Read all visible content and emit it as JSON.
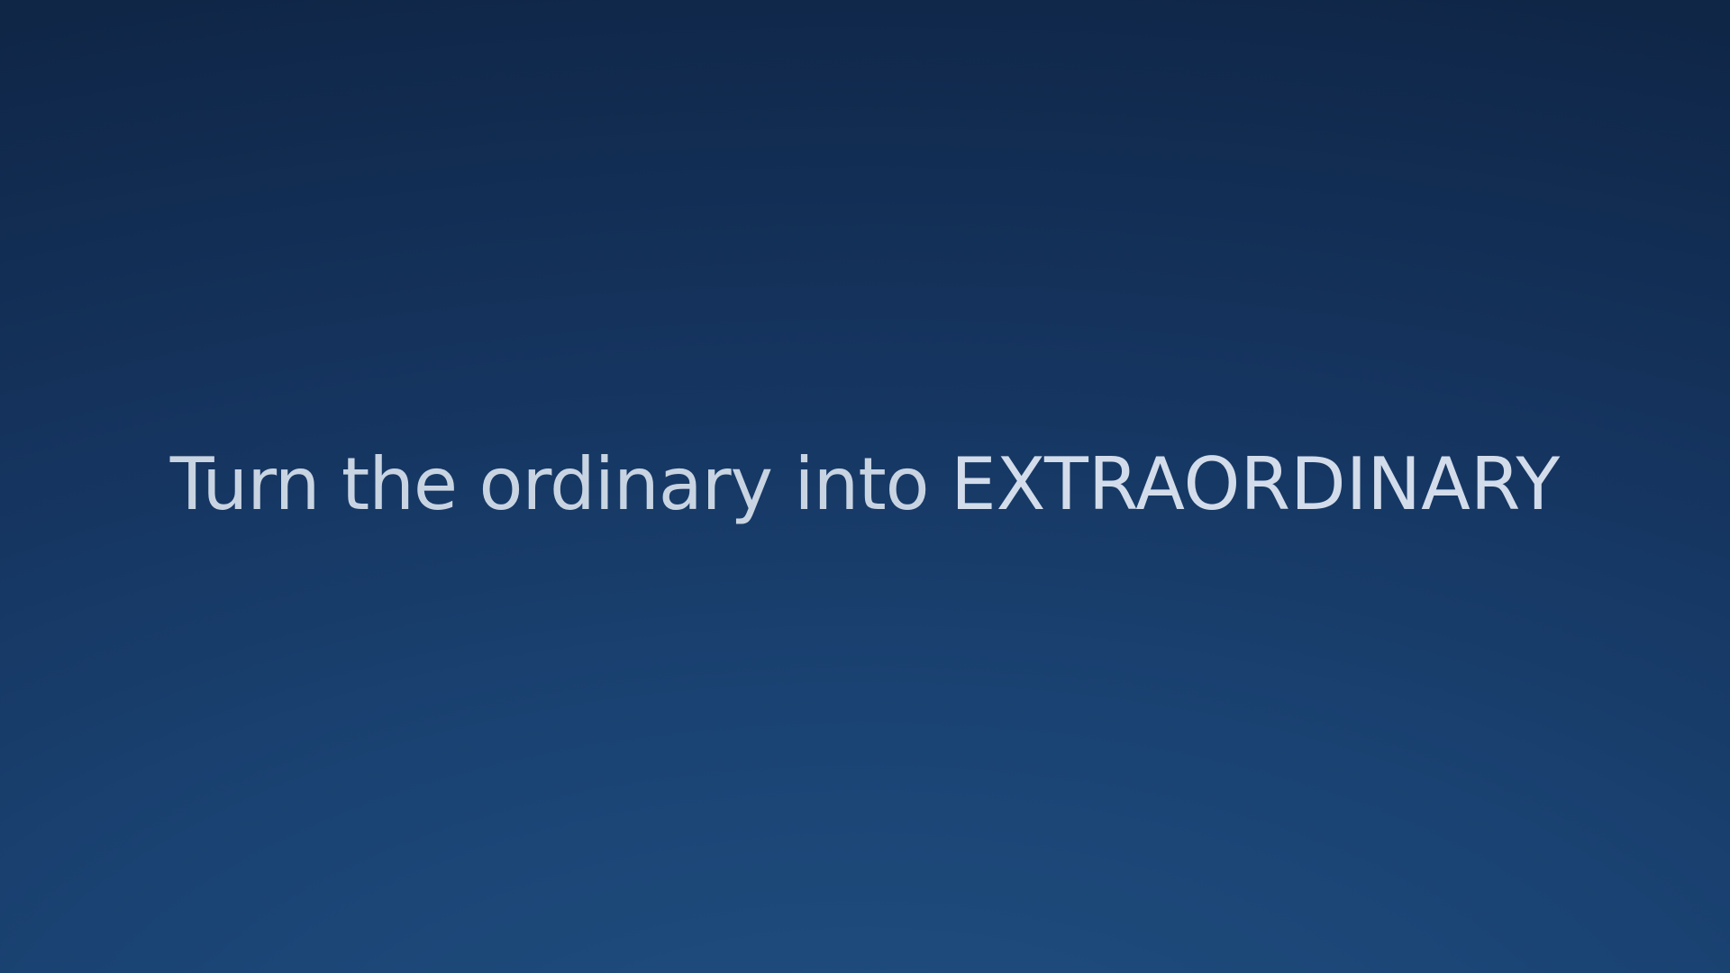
{
  "slide": {
    "lead_text": "Turn the ordinary into ",
    "emphasis_text": "EXTRAORDINARY"
  },
  "colors": {
    "background_top": "#0f2647",
    "background_bottom": "#1f4f80",
    "text": "#c9d4e2"
  }
}
